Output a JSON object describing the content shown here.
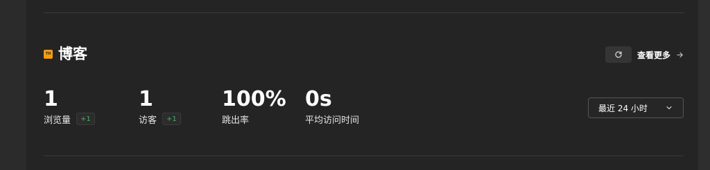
{
  "site": {
    "icon_text": "TH",
    "title": "博客",
    "accent_color": "#f39c12"
  },
  "toolbar": {
    "refresh_icon": "refresh-icon",
    "view_more_label": "查看更多",
    "view_more_icon": "arrow-right-icon"
  },
  "metrics": [
    {
      "value": "1",
      "label": "浏览量",
      "delta": "+1"
    },
    {
      "value": "1",
      "label": "访客",
      "delta": "+1"
    },
    {
      "value": "100%",
      "label": "跳出率"
    },
    {
      "value": "0s",
      "label": "平均访问时间"
    }
  ],
  "range": {
    "selected": "最近 24 小时",
    "icon": "chevron-down-icon"
  },
  "colors": {
    "background": "#242424",
    "delta_positive": "#4caf6e"
  }
}
